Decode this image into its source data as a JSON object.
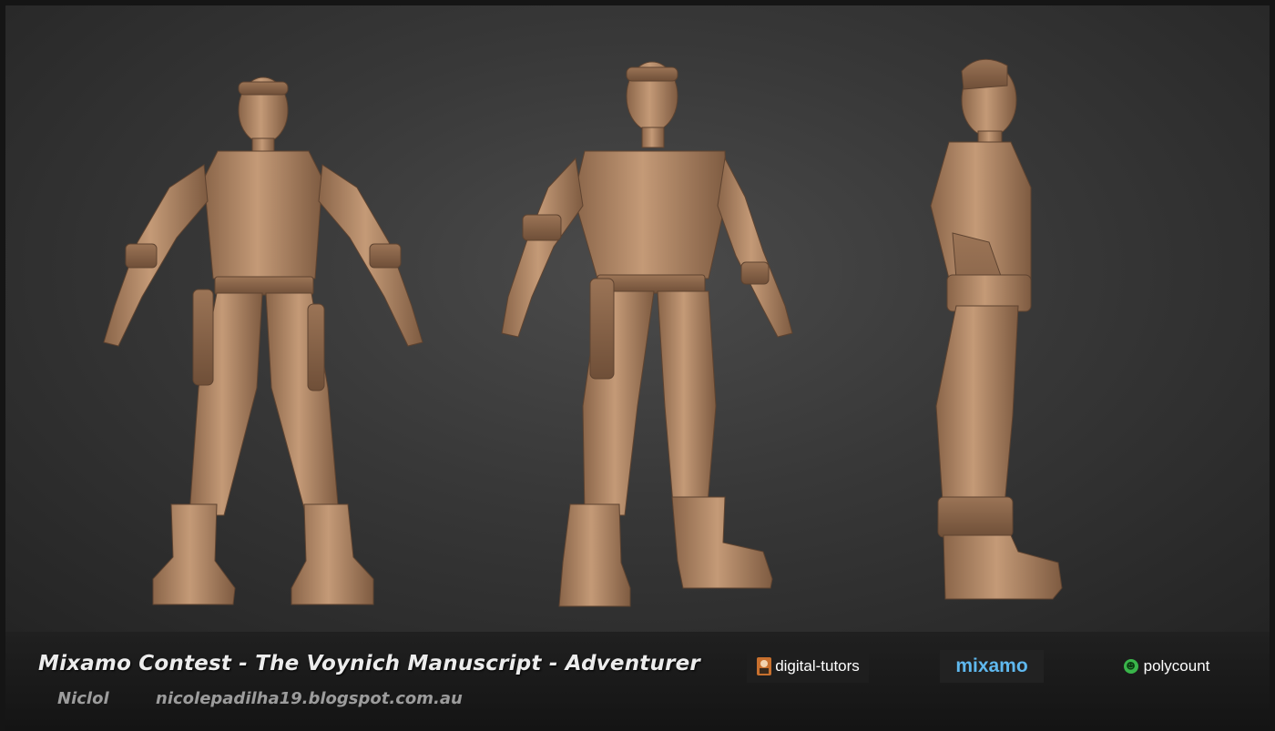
{
  "scene": {
    "background_color": "#383838",
    "figures": [
      {
        "name": "front-view",
        "color": "#b98e6c"
      },
      {
        "name": "three-quarter-view",
        "color": "#b98e6c"
      },
      {
        "name": "side-view",
        "color": "#b98e6c"
      }
    ]
  },
  "footer": {
    "title": "Mixamo Contest - The Voynich Manuscript - Adventurer",
    "author": "Niclol",
    "website": "nicolepadilha19.blogspot.com.au"
  },
  "logos": {
    "digital_tutors": "digital-tutors",
    "mixamo": "mixamo",
    "polycount": "polycount"
  }
}
